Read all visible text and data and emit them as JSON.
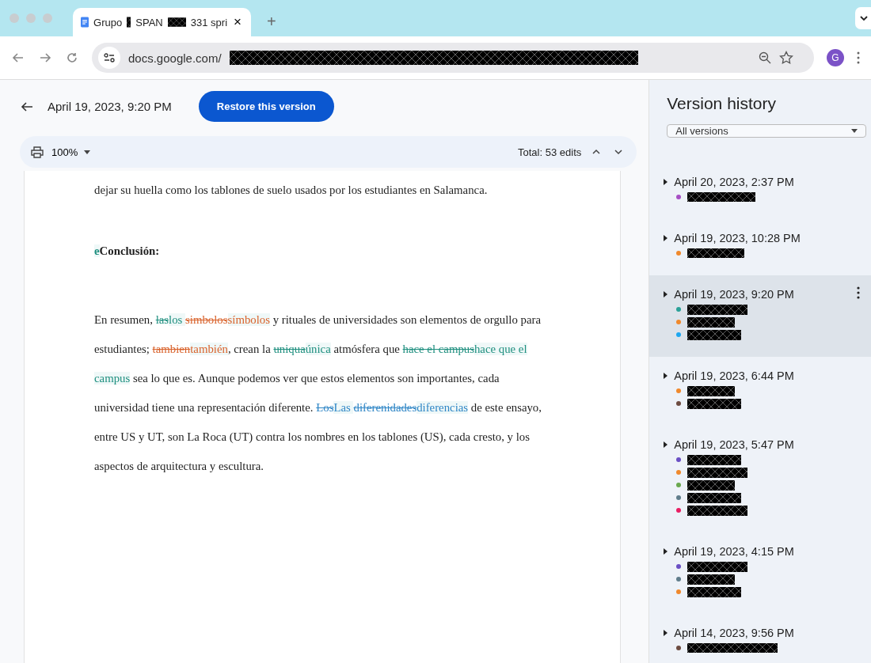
{
  "browser": {
    "tab": {
      "title_parts": [
        "Grupo",
        "SPAN",
        "331 spri"
      ],
      "close": "×"
    },
    "new_tab": "+",
    "url": "docs.google.com/",
    "avatar": "G"
  },
  "header": {
    "version_title": "April 19, 2023, 9:20 PM",
    "restore_button": "Restore this version"
  },
  "toolbar": {
    "zoom": "100%",
    "total_edits": "Total: 53 edits"
  },
  "document": {
    "paragraphs": [
      {
        "kind": "body",
        "segments": [
          {
            "kind": "plain",
            "text": "dejar su huella como los tablones de suelo usados por los estudiantes en Salamanca."
          }
        ]
      },
      {
        "kind": "heading",
        "segments": [
          {
            "kind": "inserted",
            "text": "e",
            "color": "#1f8f7f"
          },
          {
            "kind": "plain",
            "text": "Conclusión:"
          }
        ]
      },
      {
        "kind": "body",
        "segments": [
          {
            "kind": "plain",
            "text": "En resumen, "
          },
          {
            "kind": "deleted",
            "text": "las",
            "color": "#1f8f7f"
          },
          {
            "kind": "inserted",
            "text": "los ",
            "color": "#1f8f7f"
          },
          {
            "kind": "deleted",
            "text": "simbolos",
            "color": "#d9622b"
          },
          {
            "kind": "inserted",
            "text": "símbolos",
            "color": "#d9622b"
          },
          {
            "kind": "plain",
            "text": " y rituales de universidades son elementos de orgullo para estudiantes; "
          },
          {
            "kind": "deleted",
            "text": "tambien",
            "color": "#d9622b"
          },
          {
            "kind": "inserted",
            "text": "también",
            "color": "#d9622b"
          },
          {
            "kind": "plain",
            "text": ", crean la "
          },
          {
            "kind": "deleted",
            "text": "uniqua",
            "color": "#1f8f7f"
          },
          {
            "kind": "inserted",
            "text": "única",
            "color": "#1f8f7f"
          },
          {
            "kind": "plain",
            "text": " atmósfera que "
          },
          {
            "kind": "deleted",
            "text": "hace el campus",
            "color": "#1f8f7f"
          },
          {
            "kind": "inserted",
            "text": "hace que el campus",
            "color": "#1f8f7f"
          },
          {
            "kind": "plain",
            "text": " sea lo que es. Aunque podemos ver que estos elementos son importantes, cada universidad tiene una representación diferente. "
          },
          {
            "kind": "deleted",
            "text": "Los",
            "color": "#2f86c6"
          },
          {
            "kind": "inserted",
            "text": "Las ",
            "color": "#2f86c6"
          },
          {
            "kind": "deleted",
            "text": "diferenidades",
            "color": "#2f86c6"
          },
          {
            "kind": "inserted",
            "text": "diferencias",
            "color": "#2f86c6"
          },
          {
            "kind": "plain",
            "text": " de este ensayo, entre US y UT, son La Roca (UT) contra los nombres en los tablones (US), cada cresto, y los aspectos de arquitectura y escultura."
          }
        ]
      }
    ]
  },
  "version_history": {
    "title": "Version history",
    "filter": "All versions",
    "versions": [
      {
        "date": "April 20, 2023, 2:37 PM",
        "selected": false,
        "editors": [
          {
            "color": "#a64fc4"
          }
        ]
      },
      {
        "date": "April 19, 2023, 10:28 PM",
        "selected": false,
        "editors": [
          {
            "color": "#f0892c"
          }
        ]
      },
      {
        "date": "April 19, 2023, 9:20 PM",
        "selected": true,
        "editors": [
          {
            "color": "#2aa198"
          },
          {
            "color": "#f0892c"
          },
          {
            "color": "#1ea7f0"
          }
        ]
      },
      {
        "date": "April 19, 2023, 6:44 PM",
        "selected": false,
        "editors": [
          {
            "color": "#f0892c"
          },
          {
            "color": "#6d4c41"
          }
        ]
      },
      {
        "date": "April 19, 2023, 5:47 PM",
        "selected": false,
        "editors": [
          {
            "color": "#6a4fc4"
          },
          {
            "color": "#f0892c"
          },
          {
            "color": "#6aa84f"
          },
          {
            "color": "#607d8b"
          },
          {
            "color": "#e91e63"
          }
        ]
      },
      {
        "date": "April 19, 2023, 4:15 PM",
        "selected": false,
        "editors": [
          {
            "color": "#6a4fc4"
          },
          {
            "color": "#607d8b"
          },
          {
            "color": "#f0892c"
          }
        ]
      },
      {
        "date": "April 14, 2023, 9:56 PM",
        "selected": false,
        "editors": [
          {
            "color": "#6d4c41"
          }
        ]
      }
    ]
  }
}
